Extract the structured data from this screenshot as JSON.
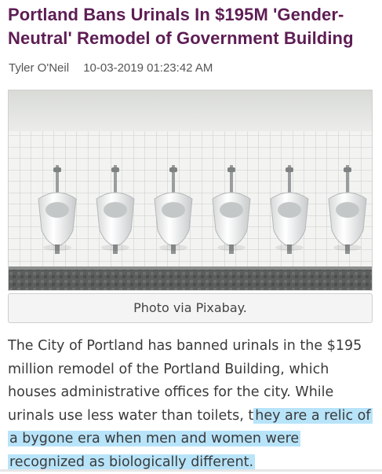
{
  "article": {
    "headline": "Portland Bans Urinals In $195M 'Gender-Neutral' Remodel of Government Building",
    "author": "Tyler O'Neil",
    "datetime": "10-03-2019 01:23:42 AM",
    "photo_caption": "Photo via Pixabay.",
    "body_plain": "The City of Portland has banned urinals in the $195 million remodel of the Portland Building, which houses administrative offices for the city. While urinals use less water than toilets, t",
    "body_highlighted": "hey are a relic of a bygone era when men and women were recognized as biologically different.",
    "highlight_color": "#7dcdf5"
  },
  "image": {
    "alt_icon": "urinals-photo",
    "urinal_count": 6
  },
  "colors": {
    "headline": "#5e1d54",
    "text": "#3a3a3a"
  }
}
